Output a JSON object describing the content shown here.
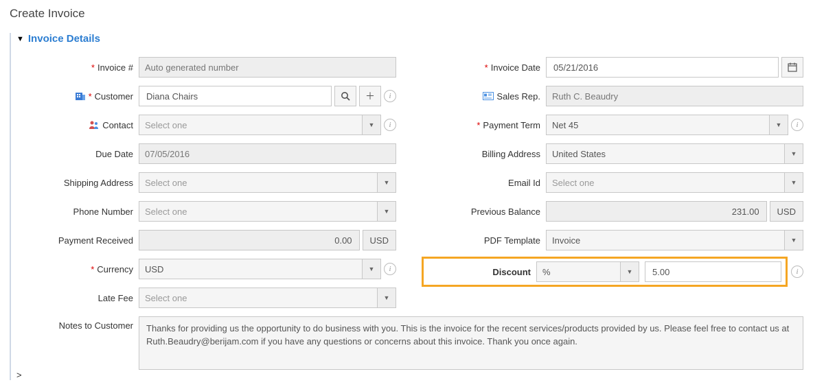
{
  "pageTitle": "Create Invoice",
  "section": {
    "title": "Invoice Details"
  },
  "left": {
    "invoiceNum": {
      "label": "Invoice #",
      "value": "Auto generated number"
    },
    "customer": {
      "label": "Customer",
      "value": "Diana Chairs"
    },
    "contact": {
      "label": "Contact",
      "placeholder": "Select one"
    },
    "dueDate": {
      "label": "Due Date",
      "value": "07/05/2016"
    },
    "shipAddr": {
      "label": "Shipping Address",
      "placeholder": "Select one"
    },
    "phone": {
      "label": "Phone Number",
      "placeholder": "Select one"
    },
    "payRecv": {
      "label": "Payment Received",
      "value": "0.00",
      "unit": "USD"
    },
    "currency": {
      "label": "Currency",
      "value": "USD"
    },
    "lateFee": {
      "label": "Late Fee",
      "placeholder": "Select one"
    }
  },
  "right": {
    "invoiceDate": {
      "label": "Invoice Date",
      "value": "05/21/2016"
    },
    "salesRep": {
      "label": "Sales Rep.",
      "value": "Ruth C. Beaudry"
    },
    "payTerm": {
      "label": "Payment Term",
      "value": "Net 45"
    },
    "billAddr": {
      "label": "Billing Address",
      "value": "United States"
    },
    "email": {
      "label": "Email Id",
      "placeholder": "Select one"
    },
    "prevBal": {
      "label": "Previous Balance",
      "value": "231.00",
      "unit": "USD"
    },
    "pdfTmpl": {
      "label": "PDF Template",
      "value": "Invoice"
    },
    "discount": {
      "label": "Discount",
      "type": "%",
      "value": "5.00"
    }
  },
  "notes": {
    "label": "Notes to Customer",
    "value": "Thanks for providing us the opportunity to do business with you. This is the invoice for the recent services/products provided by us. Please feel free to contact us at Ruth.Beaudry@berijam.com if you have any questions or concerns about this invoice. Thank you once again."
  }
}
